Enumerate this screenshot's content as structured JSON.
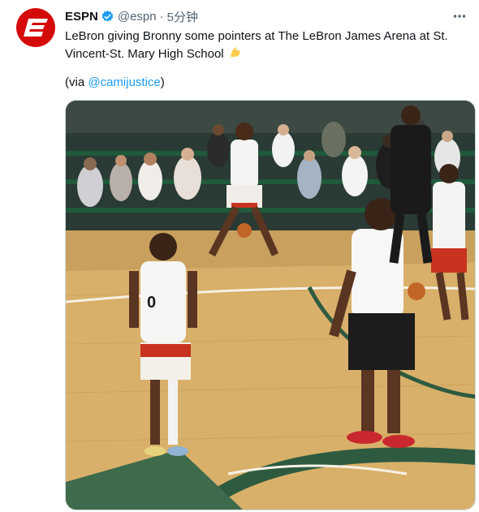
{
  "tweet": {
    "author_name": "ESPN",
    "handle": "@espn",
    "separator": "·",
    "time": "5分钟",
    "text": "LeBron giving Bronny some pointers at The LeBron James Arena at St. Vincent-St. Mary High School",
    "emoji": "flexed-biceps",
    "via_prefix": "(via ",
    "via_link": "@camijustice",
    "via_suffix": ")",
    "jersey_number": "0"
  },
  "colors": {
    "brand": "#d50a0a",
    "verified": "#1d9bf0",
    "link": "#1d9bf0"
  }
}
